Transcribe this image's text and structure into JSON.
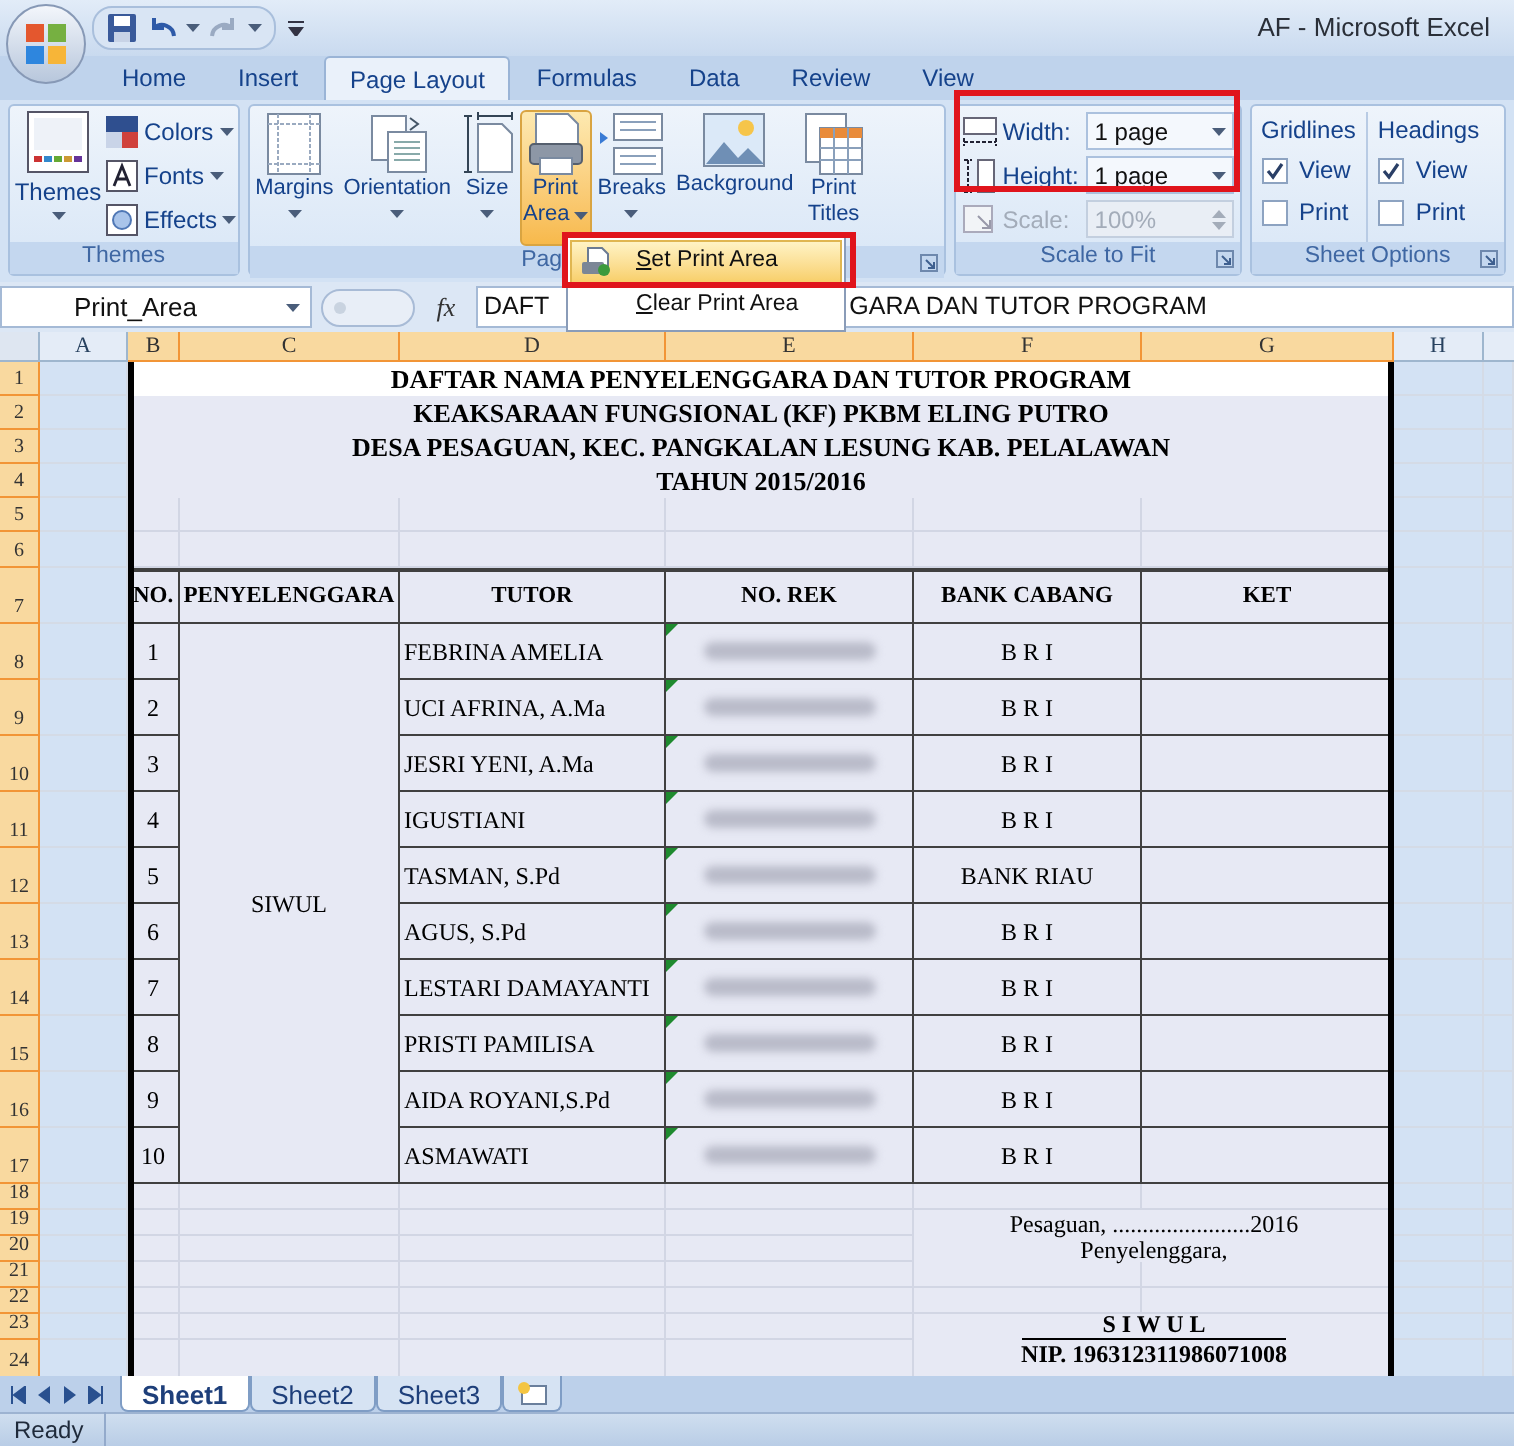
{
  "window": {
    "title": "AF - Microsoft Excel"
  },
  "ribbon_tabs": [
    {
      "label": "Home",
      "selected": false
    },
    {
      "label": "Insert",
      "selected": false
    },
    {
      "label": "Page Layout",
      "selected": true
    },
    {
      "label": "Formulas",
      "selected": false
    },
    {
      "label": "Data",
      "selected": false
    },
    {
      "label": "Review",
      "selected": false
    },
    {
      "label": "View",
      "selected": false
    }
  ],
  "themes_group": {
    "label": "Themes",
    "themes_button": "Themes",
    "items": [
      {
        "kind": "colors",
        "label": "Colors"
      },
      {
        "kind": "fonts",
        "label": "Fonts"
      },
      {
        "kind": "effects",
        "label": "Effects"
      }
    ]
  },
  "page_setup_group": {
    "label": "Pag",
    "buttons": [
      {
        "kind": "margins",
        "lines": [
          "Margins"
        ],
        "dropdown": true,
        "active": false
      },
      {
        "kind": "orientation",
        "lines": [
          "Orientation"
        ],
        "dropdown": true,
        "active": false
      },
      {
        "kind": "size",
        "lines": [
          "Size"
        ],
        "dropdown": true,
        "active": false
      },
      {
        "kind": "print_area",
        "lines": [
          "Print",
          "Area"
        ],
        "dropdown": true,
        "active": true
      },
      {
        "kind": "breaks",
        "lines": [
          "Breaks"
        ],
        "dropdown": true,
        "active": false
      },
      {
        "kind": "background",
        "lines": [
          "Background"
        ],
        "dropdown": false,
        "active": false
      },
      {
        "kind": "print_titles",
        "lines": [
          "Print",
          "Titles"
        ],
        "dropdown": false,
        "active": false
      }
    ]
  },
  "print_area_menu": {
    "items": [
      {
        "label": "Set Print Area",
        "selected": true,
        "outlined": true
      },
      {
        "label": "Clear Print Area",
        "selected": false,
        "outlined": false
      }
    ]
  },
  "scale_to_fit_group": {
    "label": "Scale to Fit",
    "outlined": true,
    "fields": [
      {
        "kind": "width",
        "label": "Width:",
        "value": "1 page",
        "disabled": false
      },
      {
        "kind": "height",
        "label": "Height:",
        "value": "1 page",
        "disabled": false
      },
      {
        "kind": "scale",
        "label": "Scale:",
        "value": "100%",
        "disabled": true
      }
    ]
  },
  "sheet_options_group": {
    "label": "Sheet Options",
    "sections": [
      {
        "heading": "Gridlines",
        "options": [
          {
            "label": "View",
            "checked": true
          },
          {
            "label": "Print",
            "checked": false
          }
        ]
      },
      {
        "heading": "Headings",
        "options": [
          {
            "label": "View",
            "checked": true
          },
          {
            "label": "Print",
            "checked": false
          }
        ]
      }
    ]
  },
  "formula_bar": {
    "name_box": "Print_Area",
    "function_label": "fx",
    "content_before_menu": "DAFT",
    "content_after_menu": "GARA DAN TUTOR PROGRAM"
  },
  "sheet": {
    "columns": [
      {
        "label": "A",
        "selected": false
      },
      {
        "label": "B",
        "selected": true
      },
      {
        "label": "C",
        "selected": true
      },
      {
        "label": "D",
        "selected": true
      },
      {
        "label": "E",
        "selected": true
      },
      {
        "label": "F",
        "selected": true
      },
      {
        "label": "G",
        "selected": true
      },
      {
        "label": "H",
        "selected": false
      }
    ],
    "rows": [
      {
        "label": "1",
        "selected": true
      },
      {
        "label": "2",
        "selected": true
      },
      {
        "label": "3",
        "selected": true
      },
      {
        "label": "4",
        "selected": true
      },
      {
        "label": "5",
        "selected": true
      },
      {
        "label": "6",
        "selected": true
      },
      {
        "label": "7",
        "selected": true
      },
      {
        "label": "8",
        "selected": true
      },
      {
        "label": "9",
        "selected": true
      },
      {
        "label": "10",
        "selected": true
      },
      {
        "label": "11",
        "selected": true
      },
      {
        "label": "12",
        "selected": true
      },
      {
        "label": "13",
        "selected": true
      },
      {
        "label": "14",
        "selected": true
      },
      {
        "label": "15",
        "selected": true
      },
      {
        "label": "16",
        "selected": true
      },
      {
        "label": "17",
        "selected": true
      },
      {
        "label": "18",
        "selected": true
      },
      {
        "label": "19",
        "selected": true
      },
      {
        "label": "20",
        "selected": true
      },
      {
        "label": "21",
        "selected": true
      },
      {
        "label": "22",
        "selected": true
      },
      {
        "label": "23",
        "selected": true
      },
      {
        "label": "24",
        "selected": true
      }
    ],
    "title_lines": [
      "DAFTAR NAMA PENYELENGGARA DAN TUTOR PROGRAM",
      "KEAKSARAAN FUNGSIONAL (KF) PKBM ELING PUTRO",
      "DESA PESAGUAN, KEC. PANGKALAN LESUNG KAB. PELALAWAN",
      "TAHUN 2015/2016"
    ],
    "table": {
      "columns": [
        "NO.",
        "PENYELENGGARA",
        "TUTOR",
        "NO. REK",
        "BANK CABANG",
        "KET"
      ],
      "organizer": "SIWUL",
      "rows": [
        {
          "no": "1",
          "tutor": "FEBRINA AMELIA",
          "bank": "B R I",
          "flagged": true
        },
        {
          "no": "2",
          "tutor": "UCI AFRINA, A.Ma",
          "bank": "B R I",
          "flagged": true
        },
        {
          "no": "3",
          "tutor": "JESRI YENI, A.Ma",
          "bank": "B R I",
          "flagged": true
        },
        {
          "no": "4",
          "tutor": "IGUSTIANI",
          "bank": "B R I",
          "flagged": true
        },
        {
          "no": "5",
          "tutor": "TASMAN, S.Pd",
          "bank": "BANK RIAU",
          "flagged": true
        },
        {
          "no": "6",
          "tutor": "AGUS, S.Pd",
          "bank": "B R I",
          "flagged": true
        },
        {
          "no": "7",
          "tutor": "LESTARI DAMAYANTI",
          "bank": "B R I",
          "flagged": true
        },
        {
          "no": "8",
          "tutor": "PRISTI PAMILISA",
          "bank": "B R I",
          "flagged": true
        },
        {
          "no": "9",
          "tutor": "AIDA ROYANI,S.Pd",
          "bank": "B R I",
          "flagged": true
        },
        {
          "no": "10",
          "tutor": "ASMAWATI",
          "bank": "B R I",
          "flagged": true
        }
      ]
    },
    "signature": {
      "place_date": "Pesaguan, .......................2016",
      "role": "Penyelenggara,",
      "name": "S I W U L",
      "id": "NIP. 196312311986071008"
    }
  },
  "sheet_tabs": [
    {
      "label": "Sheet1",
      "selected": true
    },
    {
      "label": "Sheet2",
      "selected": false
    },
    {
      "label": "Sheet3",
      "selected": false
    }
  ],
  "status_bar": {
    "text": "Ready"
  }
}
